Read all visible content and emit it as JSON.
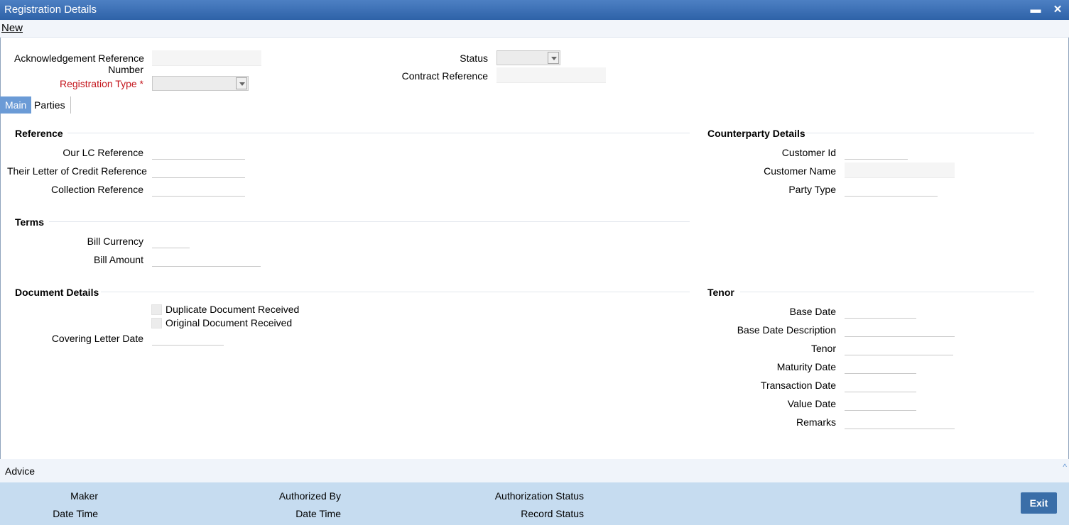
{
  "window": {
    "title": "Registration Details",
    "minimize_icon": "minimize-icon",
    "close_icon": "close-icon"
  },
  "menu": {
    "new_label": "New"
  },
  "header": {
    "ack_ref_label_line1": "Acknowledgement Reference",
    "ack_ref_label_line2": "Number",
    "ack_ref_value": "",
    "reg_type_label": "Registration Type",
    "reg_type_required": "*",
    "reg_type_value": "",
    "status_label": "Status",
    "status_value": "",
    "contract_ref_label": "Contract Reference",
    "contract_ref_value": ""
  },
  "tabs": [
    {
      "label": "Main"
    },
    {
      "label": "Parties"
    }
  ],
  "reference": {
    "title": "Reference",
    "our_lc_label": "Our LC Reference",
    "their_lc_label": "Their Letter of Credit Reference",
    "collection_label": "Collection Reference"
  },
  "counterparty": {
    "title": "Counterparty Details",
    "customer_id_label": "Customer Id",
    "customer_name_label": "Customer Name",
    "party_type_label": "Party Type"
  },
  "terms": {
    "title": "Terms",
    "bill_currency_label": "Bill Currency",
    "bill_amount_label": "Bill Amount"
  },
  "document": {
    "title": "Document Details",
    "duplicate_label": "Duplicate Document Received",
    "original_label": "Original Document Received",
    "covering_letter_label": "Covering Letter Date"
  },
  "tenor": {
    "title": "Tenor",
    "base_date_label": "Base Date",
    "base_date_desc_label": "Base Date Description",
    "tenor_label": "Tenor",
    "maturity_label": "Maturity Date",
    "transaction_label": "Transaction Date",
    "value_date_label": "Value Date",
    "remarks_label": "Remarks"
  },
  "advice": {
    "label": "Advice",
    "collapse_icon": "chevron-up-icon"
  },
  "footer": {
    "maker_label": "Maker",
    "date_time_label": "Date Time",
    "authorized_by_label": "Authorized By",
    "date_time2_label": "Date Time",
    "auth_status_label": "Authorization Status",
    "record_status_label": "Record Status",
    "exit_label": "Exit"
  }
}
